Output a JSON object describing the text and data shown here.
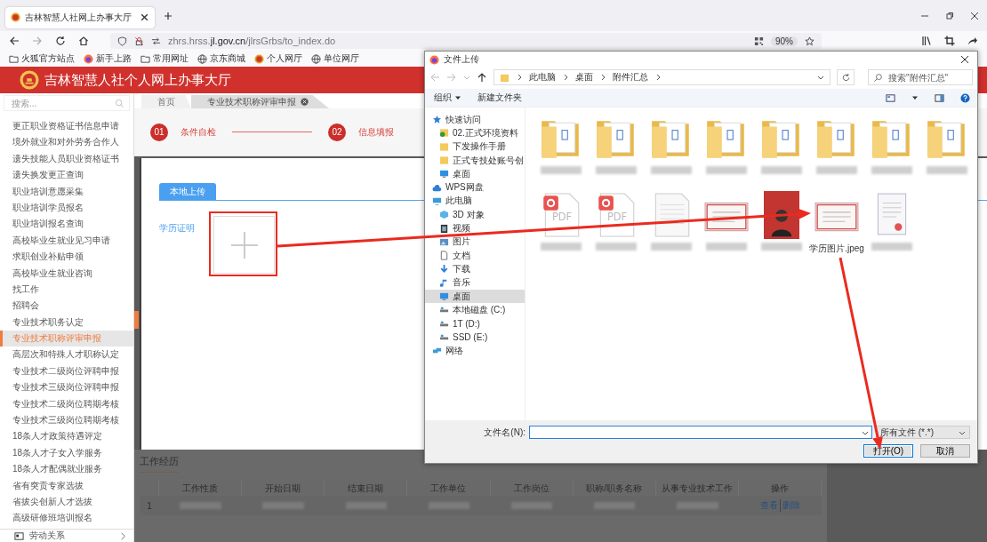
{
  "browser": {
    "tab": {
      "title": "吉林智慧人社网上办事大厅"
    },
    "url": "zhrs.hrss.**jl.gov.cn**/jlrsGrbs/to_index.do",
    "zoom": "90%",
    "bookmarks": [
      {
        "label": "火狐官方站点",
        "kind": "folder"
      },
      {
        "label": "新手上路",
        "kind": "firefox"
      },
      {
        "label": "常用网址",
        "kind": "folder"
      },
      {
        "label": "京东商城",
        "kind": "globe"
      },
      {
        "label": "个人网厅",
        "kind": "emblem"
      },
      {
        "label": "单位网厅",
        "kind": "globe"
      }
    ]
  },
  "site": {
    "title": "吉林智慧人社个人网上办事大厅",
    "sidebar": {
      "search_placeholder": "搜索...",
      "items": [
        {
          "label": "更正职业资格证书信息申请",
          "selected": false
        },
        {
          "label": "境外就业和对外劳务合作人",
          "selected": false
        },
        {
          "label": "遗失技能人员职业资格证书",
          "selected": false
        },
        {
          "label": "遗失换发更正查询",
          "selected": false
        },
        {
          "label": "职业培训意愿采集",
          "selected": false
        },
        {
          "label": "职业培训学员报名",
          "selected": false
        },
        {
          "label": "职业培训报名查询",
          "selected": false
        },
        {
          "label": "高校毕业生就业见习申请",
          "selected": false
        },
        {
          "label": "求职创业补贴申领",
          "selected": false
        },
        {
          "label": "高校毕业生就业咨询",
          "selected": false
        },
        {
          "label": "找工作",
          "selected": false
        },
        {
          "label": "招聘会",
          "selected": false
        },
        {
          "label": "专业技术职务认定",
          "selected": false
        },
        {
          "label": "专业技术职称评审申报",
          "selected": true
        },
        {
          "label": "高层次和特殊人才职称认定",
          "selected": false
        },
        {
          "label": "专业技术二级岗位评聘申报",
          "selected": false
        },
        {
          "label": "专业技术三级岗位评聘申报",
          "selected": false
        },
        {
          "label": "专业技术二级岗位聘期考核",
          "selected": false
        },
        {
          "label": "专业技术三级岗位聘期考核",
          "selected": false
        },
        {
          "label": "18条人才政策待遇评定",
          "selected": false
        },
        {
          "label": "18条人才子女入学服务",
          "selected": false
        },
        {
          "label": "18条人才配偶就业服务",
          "selected": false
        },
        {
          "label": "省有突贡专家选拔",
          "selected": false
        },
        {
          "label": "省拔尖创新人才选拔",
          "selected": false
        },
        {
          "label": "高级研修班培训报名",
          "selected": false
        }
      ],
      "footer": "劳动关系"
    },
    "breadcrumbs": [
      {
        "label": "首页",
        "selected": false
      },
      {
        "label": "专业技术职称评审申报",
        "selected": true
      }
    ],
    "steps": [
      {
        "number": "01",
        "label": "条件自检"
      },
      {
        "number": "02",
        "label": "信息填报"
      }
    ],
    "upload": {
      "tab": "本地上传",
      "field_label": "学历证明"
    },
    "work_history": {
      "title": "工作经历",
      "columns": [
        "工作性质",
        "开始日期",
        "结束日期",
        "工作单位",
        "工作岗位",
        "职称/职务名称",
        "从事专业技术工作",
        "操作"
      ],
      "rows": [
        {
          "index": "1",
          "actions": [
            "查看",
            "删除"
          ]
        }
      ]
    }
  },
  "dialog": {
    "title": "文件上传",
    "path": [
      "此电脑",
      "桌面",
      "附件汇总"
    ],
    "search_placeholder": "搜索\"附件汇总\"",
    "organize": "组织",
    "new_folder": "新建文件夹",
    "nav": [
      {
        "label": "快速访问",
        "kind": "star",
        "selected": false,
        "children": [
          {
            "label": "02.正式环境资料",
            "kind": "synced-folder",
            "selected": false
          },
          {
            "label": "下发操作手册",
            "kind": "folder",
            "selected": false
          },
          {
            "label": "正式专技处账号创",
            "kind": "folder",
            "selected": false
          },
          {
            "label": "桌面",
            "kind": "desktop",
            "selected": false
          }
        ]
      },
      {
        "label": "WPS网盘",
        "kind": "cloud",
        "selected": false
      },
      {
        "label": "此电脑",
        "kind": "computer",
        "selected": false,
        "children": [
          {
            "label": "3D 对象",
            "kind": "cube",
            "selected": false
          },
          {
            "label": "视频",
            "kind": "video",
            "selected": false
          },
          {
            "label": "图片",
            "kind": "picture",
            "selected": false
          },
          {
            "label": "文档",
            "kind": "document",
            "selected": false
          },
          {
            "label": "下载",
            "kind": "download",
            "selected": false
          },
          {
            "label": "音乐",
            "kind": "music",
            "selected": false
          },
          {
            "label": "桌面",
            "kind": "desktop",
            "selected": true
          },
          {
            "label": "本地磁盘 (C:)",
            "kind": "drive",
            "selected": false
          },
          {
            "label": "1T (D:)",
            "kind": "drive",
            "selected": false
          },
          {
            "label": "SSD (E:)",
            "kind": "drive",
            "selected": false
          }
        ]
      },
      {
        "label": "网络",
        "kind": "network",
        "selected": false
      }
    ],
    "files": [
      {
        "kind": "folder"
      },
      {
        "kind": "folder"
      },
      {
        "kind": "folder"
      },
      {
        "kind": "folder"
      },
      {
        "kind": "folder"
      },
      {
        "kind": "folder"
      },
      {
        "kind": "folder"
      },
      {
        "kind": "folder"
      },
      {
        "kind": "pdf",
        "badge": "PDF"
      },
      {
        "kind": "pdf",
        "badge": "PDF"
      },
      {
        "kind": "document"
      },
      {
        "kind": "certificate"
      },
      {
        "kind": "photo"
      },
      {
        "kind": "certificate",
        "name": "学历图片.jpeg"
      },
      {
        "kind": "portrait-document"
      }
    ],
    "filename_label": "文件名(N):",
    "filter": "所有文件 (*.*)",
    "buttons": [
      {
        "label": "打开(O)",
        "kind": "primary"
      },
      {
        "label": "取消",
        "kind": "normal"
      }
    ]
  }
}
